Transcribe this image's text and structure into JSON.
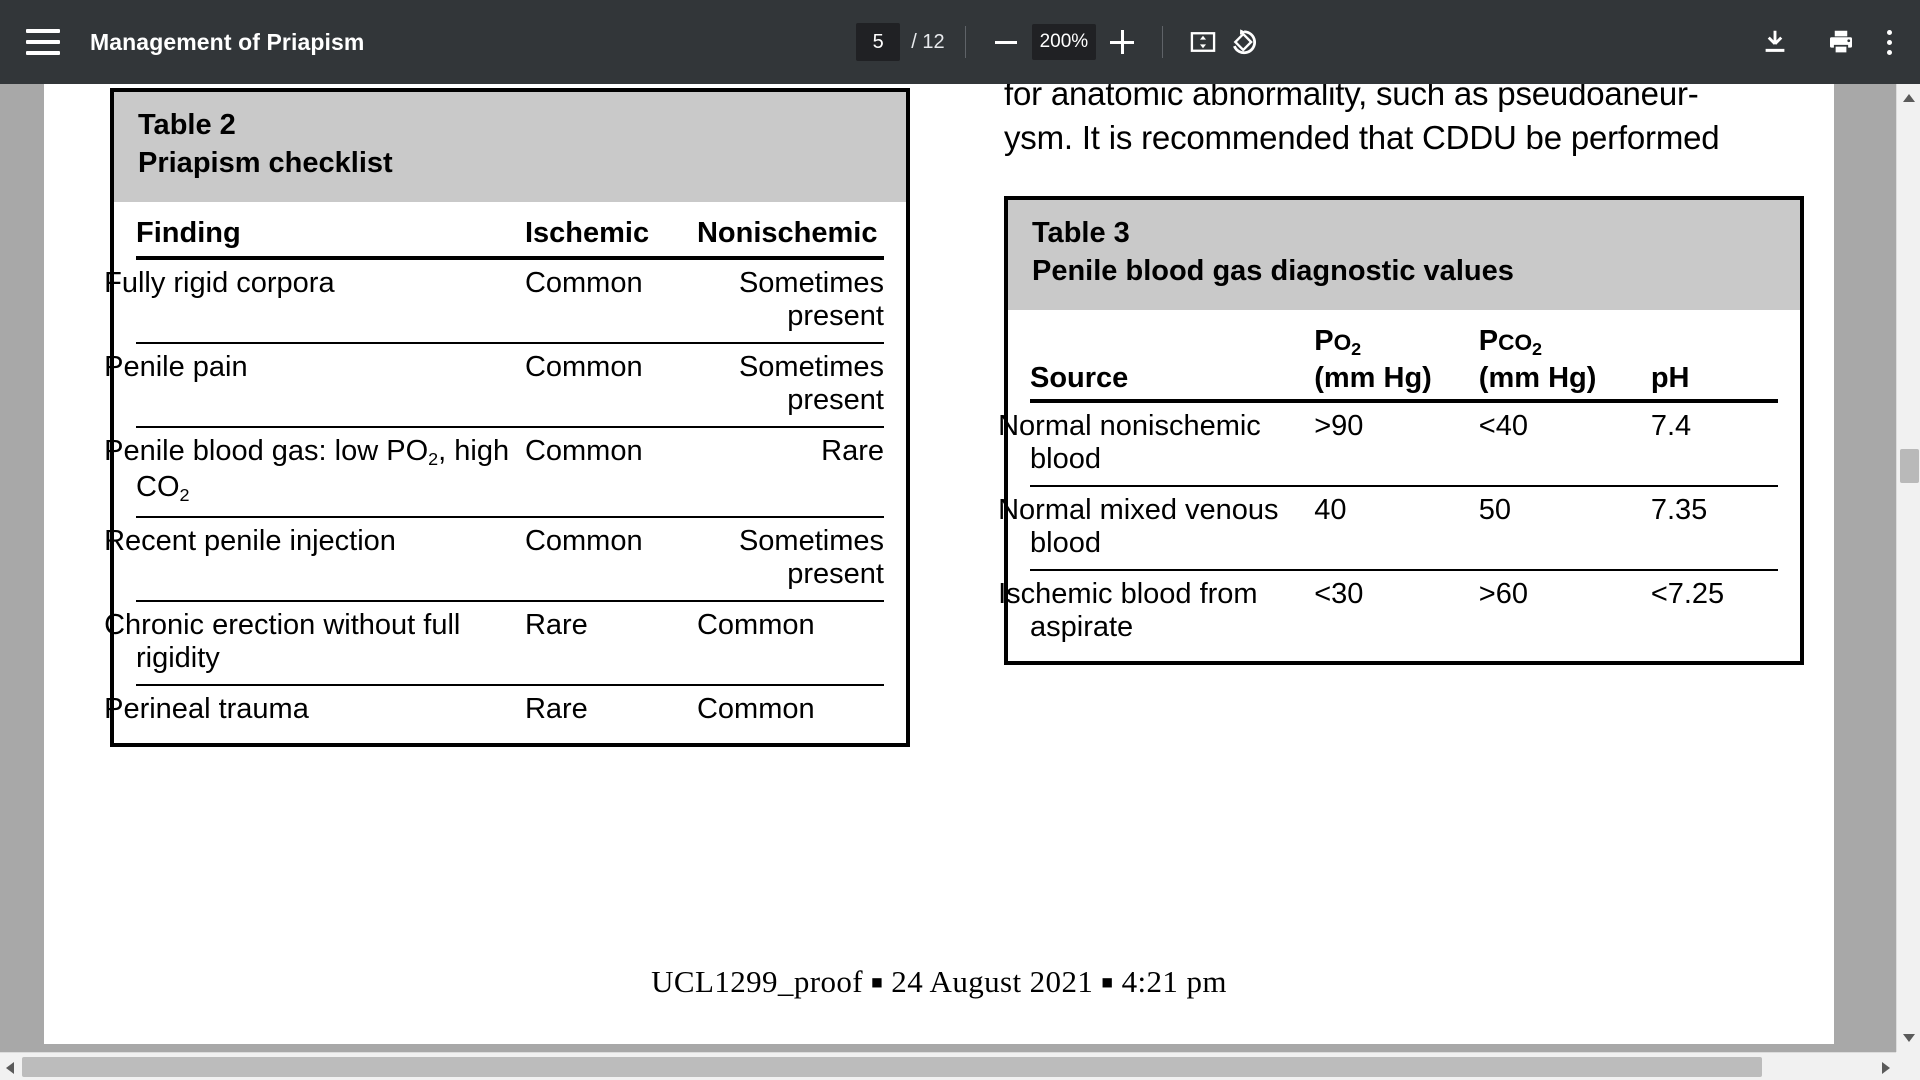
{
  "toolbar": {
    "menu_icon": "hamburger-menu-icon",
    "title": "Management of Priapism",
    "page_current": "5",
    "page_total": "/ 12",
    "zoom_out_icon": "minus-icon",
    "zoom_level": "200%",
    "zoom_in_icon": "plus-icon",
    "fit_page_icon": "fit-to-page-icon",
    "rotate_icon": "rotate-counterclockwise-icon",
    "download_icon": "download-icon",
    "print_icon": "print-icon",
    "more_icon": "more-options-icon",
    "bg_color": "#323639"
  },
  "document": {
    "body_text_lines": [
      "for anatomic abnormality, such as pseudoaneur-",
      "ysm. It is recommended that CDDU be performed"
    ],
    "footer": {
      "proof_id": "UCL1299_proof",
      "date": "24 August 2021",
      "time": "4:21 pm",
      "separator": "■"
    },
    "table2": {
      "number": "Table 2",
      "title": "Priapism checklist",
      "header_bg": "#c9c9c9",
      "columns": [
        "Finding",
        "Ischemic",
        "Nonischemic"
      ],
      "rows": [
        {
          "finding": "Fully rigid corpora",
          "ischemic": "Common",
          "nonischemic": "Sometimes present"
        },
        {
          "finding": "Penile pain",
          "ischemic": "Common",
          "nonischemic": "Sometimes present"
        },
        {
          "finding": "Penile blood gas: low PO2, high CO2",
          "ischemic": "Common",
          "nonischemic": "Rare"
        },
        {
          "finding": "Recent penile injection",
          "ischemic": "Common",
          "nonischemic": "Sometimes present"
        },
        {
          "finding": "Chronic erection without full rigidity",
          "ischemic": "Rare",
          "nonischemic": "Common"
        },
        {
          "finding": "Perineal trauma",
          "ischemic": "Rare",
          "nonischemic": "Common"
        }
      ]
    },
    "table3": {
      "number": "Table 3",
      "title": "Penile blood gas diagnostic values",
      "header_bg": "#c9c9c9",
      "columns": [
        "Source",
        "Po2 (mm Hg)",
        "Pco2 (mm Hg)",
        "pH"
      ],
      "column_units": [
        "",
        "(mm Hg)",
        "(mm Hg)",
        ""
      ],
      "rows": [
        {
          "source": "Normal nonischemic blood",
          "po2": ">90",
          "pco2": "<40",
          "ph": "7.4"
        },
        {
          "source": "Normal mixed venous blood",
          "po2": "40",
          "pco2": "50",
          "ph": "7.35"
        },
        {
          "source": "Ischemic blood from aspirate",
          "po2": "<30",
          "pco2": ">60",
          "ph": "<7.25"
        }
      ]
    }
  }
}
